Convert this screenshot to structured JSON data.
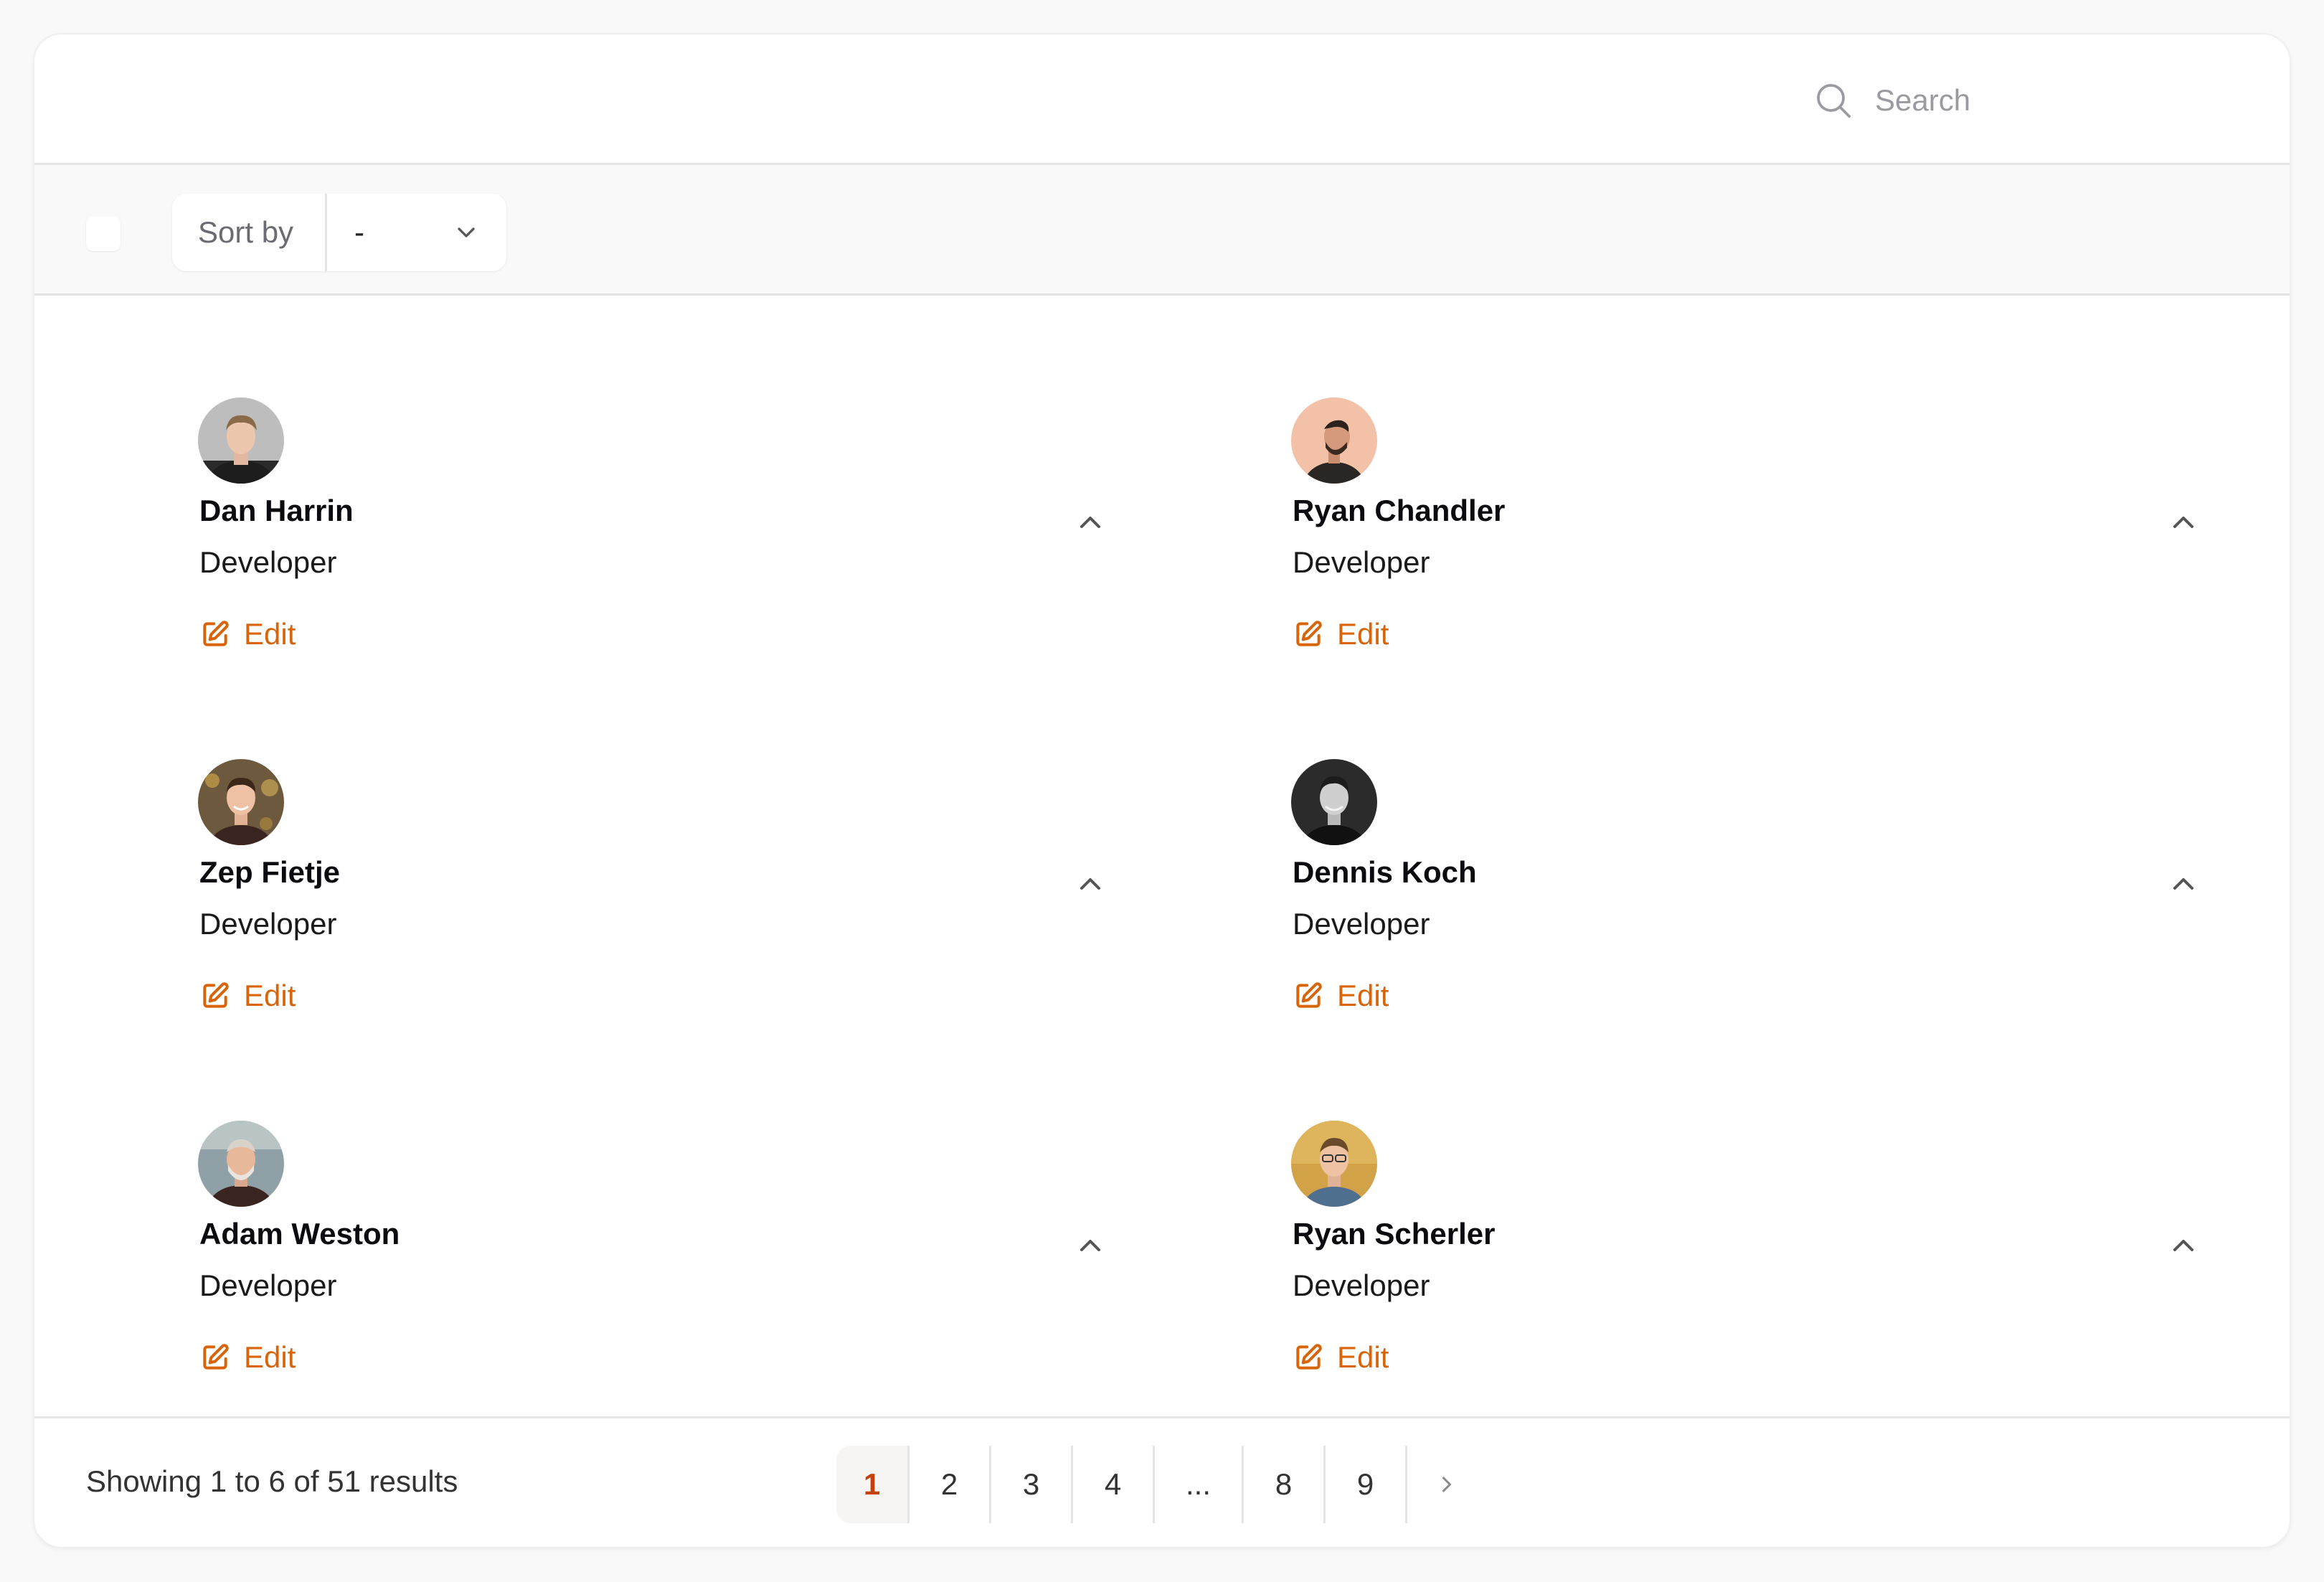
{
  "search": {
    "placeholder": "Search"
  },
  "toolbar": {
    "sort_label": "Sort by",
    "sort_value": "-"
  },
  "colors": {
    "accent": "#d9650b",
    "border": "#e4e4e7"
  },
  "cards": [
    {
      "name": "Dan Harrin",
      "role": "Developer",
      "edit_label": "Edit"
    },
    {
      "name": "Ryan Chandler",
      "role": "Developer",
      "edit_label": "Edit"
    },
    {
      "name": "Zep Fietje",
      "role": "Developer",
      "edit_label": "Edit"
    },
    {
      "name": "Dennis Koch",
      "role": "Developer",
      "edit_label": "Edit"
    },
    {
      "name": "Adam Weston",
      "role": "Developer",
      "edit_label": "Edit"
    },
    {
      "name": "Ryan Scherler",
      "role": "Developer",
      "edit_label": "Edit"
    }
  ],
  "footer": {
    "results_text": "Showing 1 to 6 of 51 results",
    "pages": [
      "1",
      "2",
      "3",
      "4",
      "...",
      "8",
      "9"
    ],
    "current_page": "1"
  }
}
